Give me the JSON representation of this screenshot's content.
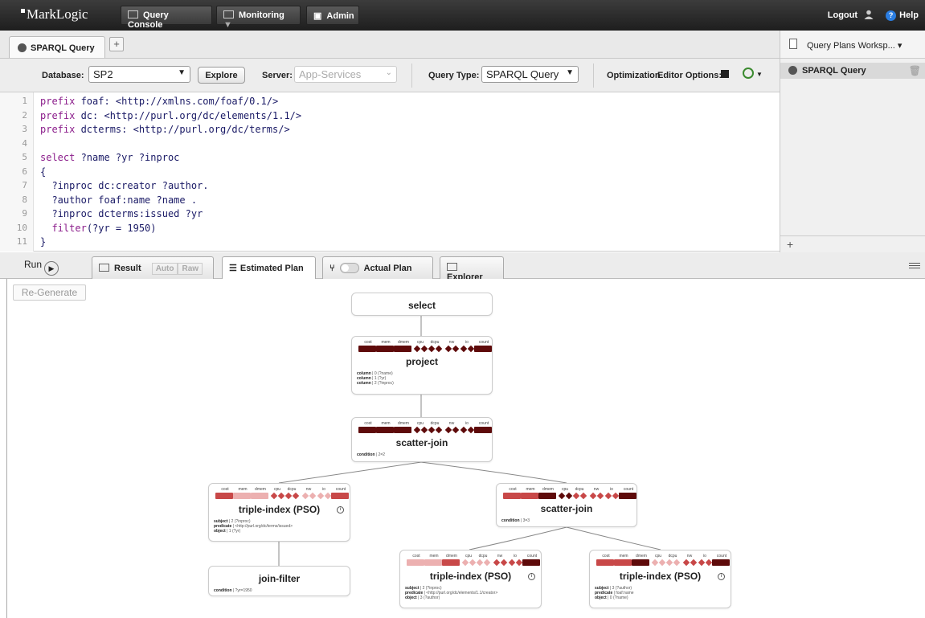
{
  "topbar": {
    "logo": "MarkLogic",
    "nav": [
      {
        "label": "Query Console"
      },
      {
        "label": "Monitoring"
      },
      {
        "label": "Admin"
      }
    ],
    "logout": "Logout",
    "help": "Help"
  },
  "tabs": {
    "query_tab": "SPARQL Query",
    "add": "+"
  },
  "toolbar": {
    "database_label": "Database:",
    "database_value": "SP2",
    "explore": "Explore",
    "server_label": "Server:",
    "server_value": "App-Services",
    "query_type_label": "Query Type:",
    "query_type_value": "SPARQL Query",
    "optimization_label": "Optimization",
    "editor_options_label": "Editor Options:"
  },
  "editor": {
    "lines": [
      {
        "n": "1",
        "text": "prefix foaf: <http://xmlns.com/foaf/0.1/>"
      },
      {
        "n": "2",
        "text": "prefix dc: <http://purl.org/dc/elements/1.1/>"
      },
      {
        "n": "3",
        "text": "prefix dcterms: <http://purl.org/dc/terms/>"
      },
      {
        "n": "4",
        "text": ""
      },
      {
        "n": "5",
        "text": "select ?name ?yr ?inproc"
      },
      {
        "n": "6",
        "text": "{"
      },
      {
        "n": "7",
        "text": "  ?inproc dc:creator ?author."
      },
      {
        "n": "8",
        "text": "  ?author foaf:name ?name ."
      },
      {
        "n": "9",
        "text": "  ?inproc dcterms:issued ?yr"
      },
      {
        "n": "10",
        "text": "  filter(?yr = 1950)"
      },
      {
        "n": "11",
        "text": "}"
      }
    ]
  },
  "workspace": {
    "title": "Query Plans Worksp...",
    "item": "SPARQL Query",
    "add": "+"
  },
  "results_bar": {
    "run": "Run",
    "result": "Result",
    "auto": "Auto",
    "raw": "Raw",
    "estimated_plan": "Estimated Plan",
    "actual_plan": "Actual Plan",
    "explorer": "Explorer"
  },
  "plan": {
    "regenerate": "Re-Generate",
    "metric_labels": [
      "cost",
      "mem",
      "dmem",
      "cpu",
      "dcpu",
      "nw",
      "io",
      "count"
    ],
    "colors": {
      "dark": "#5e0a0a",
      "mid": "#c84848",
      "light": "#ecb0b0"
    },
    "nodes": [
      {
        "id": "select",
        "title": "select",
        "attrs": []
      },
      {
        "id": "project",
        "title": "project",
        "shades": [
          "dark",
          "dark",
          "dark",
          "dark",
          "dark",
          "dark",
          "dark",
          "dark"
        ],
        "attrs": [
          {
            "k": "column",
            "v": "0 (?name)"
          },
          {
            "k": "column",
            "v": "1 (?yr)"
          },
          {
            "k": "column",
            "v": "2 (?inproc)"
          }
        ]
      },
      {
        "id": "scatter1",
        "title": "scatter-join",
        "shades": [
          "dark",
          "dark",
          "dark",
          "dark",
          "dark",
          "dark",
          "dark",
          "dark"
        ],
        "attrs": [
          {
            "k": "condition",
            "v": "2=2"
          }
        ]
      },
      {
        "id": "triple1",
        "title": "triple-index (PSO)",
        "shades": [
          "mid",
          "light",
          "light",
          "mid",
          "mid",
          "light",
          "light",
          "mid"
        ],
        "attrs": [
          {
            "k": "subject",
            "v": "2 (?inproc)"
          },
          {
            "k": "predicate",
            "v": "<http://purl.org/dc/terms/issued>"
          },
          {
            "k": "object",
            "v": "1 (?yr)"
          }
        ]
      },
      {
        "id": "scatter2",
        "title": "scatter-join",
        "shades": [
          "mid",
          "mid",
          "dark",
          "dark",
          "mid",
          "mid",
          "mid",
          "dark"
        ],
        "attrs": [
          {
            "k": "condition",
            "v": "3=3"
          }
        ]
      },
      {
        "id": "joinfilter",
        "title": "join-filter",
        "attrs": [
          {
            "k": "condition",
            "v": "?yr=1950"
          }
        ]
      },
      {
        "id": "triple2",
        "title": "triple-index (PSO)",
        "shades": [
          "light",
          "light",
          "mid",
          "light",
          "light",
          "mid",
          "mid",
          "dark"
        ],
        "attrs": [
          {
            "k": "subject",
            "v": "2 (?inproc)"
          },
          {
            "k": "predicate",
            "v": "<http://purl.org/dc/elements/1.1/creator>"
          },
          {
            "k": "object",
            "v": "3 (?author)"
          }
        ]
      },
      {
        "id": "triple3",
        "title": "triple-index (PSO)",
        "shades": [
          "mid",
          "mid",
          "dark",
          "light",
          "light",
          "mid",
          "mid",
          "dark"
        ],
        "attrs": [
          {
            "k": "subject",
            "v": "3 (?author)"
          },
          {
            "k": "predicate",
            "v": "foaf:name"
          },
          {
            "k": "object",
            "v": "0 (?name)"
          }
        ]
      }
    ]
  }
}
